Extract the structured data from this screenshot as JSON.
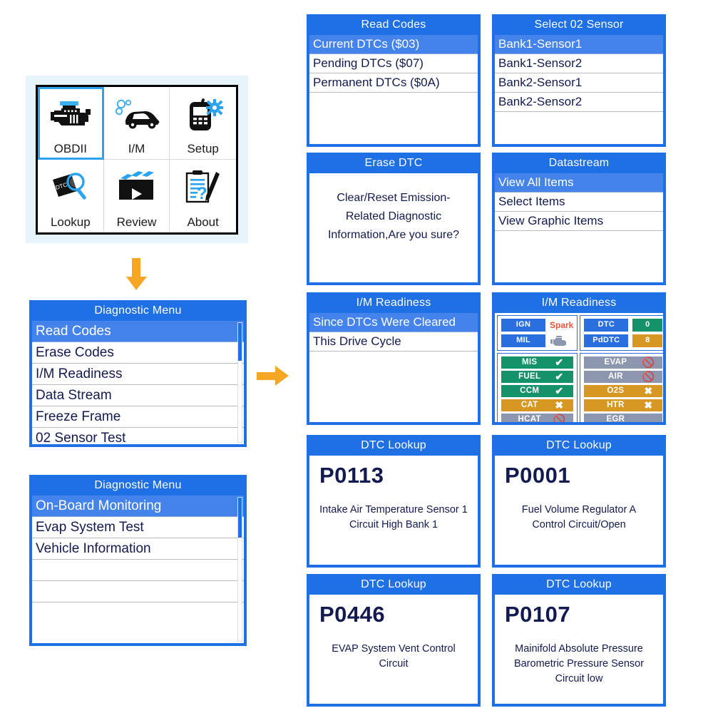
{
  "home": {
    "name": "obd-scanner-home",
    "cells": [
      {
        "label": "OBDII",
        "icon": "engine-icon",
        "selected": true
      },
      {
        "label": "I/M",
        "icon": "car-emission-icon",
        "selected": false
      },
      {
        "label": "Setup",
        "icon": "scan-tool-gear-icon",
        "selected": false
      },
      {
        "label": "Lookup",
        "icon": "dtc-magnifier-icon",
        "selected": false
      },
      {
        "label": "Review",
        "icon": "clapperboard-icon",
        "selected": false
      },
      {
        "label": "About",
        "icon": "clipboard-pen-icon",
        "selected": false
      }
    ]
  },
  "arrows": {
    "down": "arrow-down-icon",
    "right": "arrow-right-icon"
  },
  "diagnostic_menu_1": {
    "title": "Diagnostic Menu",
    "items": [
      {
        "label": "Read Codes",
        "selected": true
      },
      {
        "label": "Erase Codes",
        "selected": false
      },
      {
        "label": "I/M Readiness",
        "selected": false
      },
      {
        "label": "Data Stream",
        "selected": false
      },
      {
        "label": "Freeze Frame",
        "selected": false
      },
      {
        "label": "02 Sensor Test",
        "selected": false
      }
    ]
  },
  "diagnostic_menu_2": {
    "title": "Diagnostic Menu",
    "items": [
      {
        "label": "On-Board Monitoring",
        "selected": true
      },
      {
        "label": "Evap System Test",
        "selected": false
      },
      {
        "label": "Vehicle Information",
        "selected": false
      },
      {
        "label": "",
        "selected": false
      },
      {
        "label": "",
        "selected": false
      },
      {
        "label": "",
        "selected": false
      }
    ]
  },
  "read_codes": {
    "title": "Read Codes",
    "items": [
      {
        "label": "Current DTCs ($03)",
        "selected": true
      },
      {
        "label": "Pending DTCs ($07)",
        "selected": false
      },
      {
        "label": "Permanent DTCs ($0A)",
        "selected": false
      }
    ]
  },
  "select_o2_sensor": {
    "title": "Select 02 Sensor",
    "items": [
      {
        "label": "Bank1-Sensor1",
        "selected": true
      },
      {
        "label": "Bank1-Sensor2",
        "selected": false
      },
      {
        "label": "Bank2-Sensor1",
        "selected": false
      },
      {
        "label": "Bank2-Sensor2",
        "selected": false
      }
    ]
  },
  "erase_dtc": {
    "title": "Erase DTC",
    "message": "Clear/Reset Emission-Related Diagnostic Information,Are you sure?"
  },
  "datastream": {
    "title": "Datastream",
    "items": [
      {
        "label": "View All Items",
        "selected": true
      },
      {
        "label": "Select Items",
        "selected": false
      },
      {
        "label": "View Graphic Items",
        "selected": false
      }
    ]
  },
  "im_readiness_menu": {
    "title": "I/M Readiness",
    "items": [
      {
        "label": "Since DTCs Were Cleared",
        "selected": true
      },
      {
        "label": "This Drive Cycle",
        "selected": false
      }
    ]
  },
  "im_readiness_status": {
    "title": "I/M Readiness",
    "top_left": {
      "ign_label": "IGN",
      "ign_value": "Spark",
      "mil_label": "MIL",
      "mil_icon": "engine-warning-icon"
    },
    "top_right": {
      "dtc_label": "DTC",
      "dtc_value": "0",
      "pddtc_label": "PdDTC",
      "pddtc_value": "8"
    },
    "monitors_left": [
      {
        "label": "MIS",
        "state": "ok",
        "mark": "check",
        "color": "#16926a"
      },
      {
        "label": "FUEL",
        "state": "ok",
        "mark": "check",
        "color": "#16926a"
      },
      {
        "label": "CCM",
        "state": "ok",
        "mark": "check",
        "color": "#16926a"
      },
      {
        "label": "CAT",
        "state": "inc",
        "mark": "cross",
        "color": "#d79723"
      },
      {
        "label": "HCAT",
        "state": "na",
        "mark": "banned",
        "color": "#8c96ae"
      }
    ],
    "monitors_right": [
      {
        "label": "EVAP",
        "state": "na",
        "mark": "banned",
        "color": "#8c96ae"
      },
      {
        "label": "AIR",
        "state": "na",
        "mark": "banned",
        "color": "#8c96ae"
      },
      {
        "label": "O2S",
        "state": "inc",
        "mark": "cross",
        "color": "#d79723"
      },
      {
        "label": "HTR",
        "state": "inc",
        "mark": "cross",
        "color": "#d79723"
      },
      {
        "label": "EGR",
        "state": "na",
        "mark": "",
        "color": "#8c96ae"
      }
    ]
  },
  "dtc_lookup_1": {
    "title": "DTC Lookup",
    "code": "P0113",
    "description": "Intake Air Temperature Sensor 1 Circuit High Bank 1"
  },
  "dtc_lookup_2": {
    "title": "DTC Lookup",
    "code": "P0001",
    "description": "Fuel Volume Regulator A Control Circuit/Open"
  },
  "dtc_lookup_3": {
    "title": "DTC Lookup",
    "code": "P0446",
    "description": "EVAP System Vent Control Circuit"
  },
  "dtc_lookup_4": {
    "title": "DTC Lookup",
    "code": "P0107",
    "description": "Mainifold Absolute Pressure Barometric Pressure Sensor Circuit low"
  },
  "colors": {
    "header_blue": "#1f6fe5",
    "select_blue": "#4583ec",
    "text_navy": "#131a4f",
    "accent_orange": "#f5a623",
    "ok_green": "#16926a",
    "inc_amber": "#d79723",
    "na_gray": "#8c96ae",
    "spark_red": "#e8533a",
    "home_backdrop": "#e8f4fc"
  }
}
